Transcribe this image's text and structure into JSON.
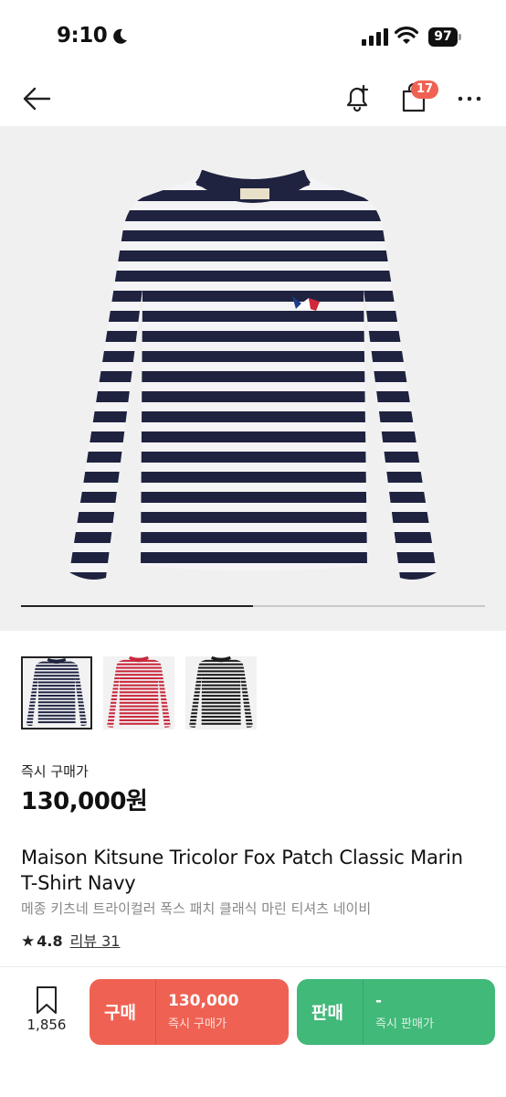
{
  "status_bar": {
    "time": "9:10",
    "battery": "97"
  },
  "nav": {
    "cart_badge": "17"
  },
  "gallery": {
    "progress": 0.5,
    "thumbnail_colors": [
      "navy",
      "red",
      "black"
    ],
    "selected_index": 0
  },
  "colors": {
    "buy": "#ef6253",
    "sell": "#41b979",
    "navy": "#1f2340",
    "red": "#c8283b",
    "black": "#1c1c1c"
  },
  "product": {
    "price_label": "즉시 구매가",
    "price": "130,000원",
    "title_en": "Maison Kitsune Tricolor Fox Patch Classic Marin T-Shirt Navy",
    "title_ko": "메종 키츠네 트라이컬러 폭스 패치 클래식 마린 티셔츠 네이비",
    "rating": "4.8",
    "review_label": "리뷰 31"
  },
  "bottom_bar": {
    "bookmark_count": "1,856",
    "buy": {
      "label": "구매",
      "price": "130,000",
      "sub": "즉시 구매가"
    },
    "sell": {
      "label": "판매",
      "price": "-",
      "sub": "즉시 판매가"
    }
  }
}
